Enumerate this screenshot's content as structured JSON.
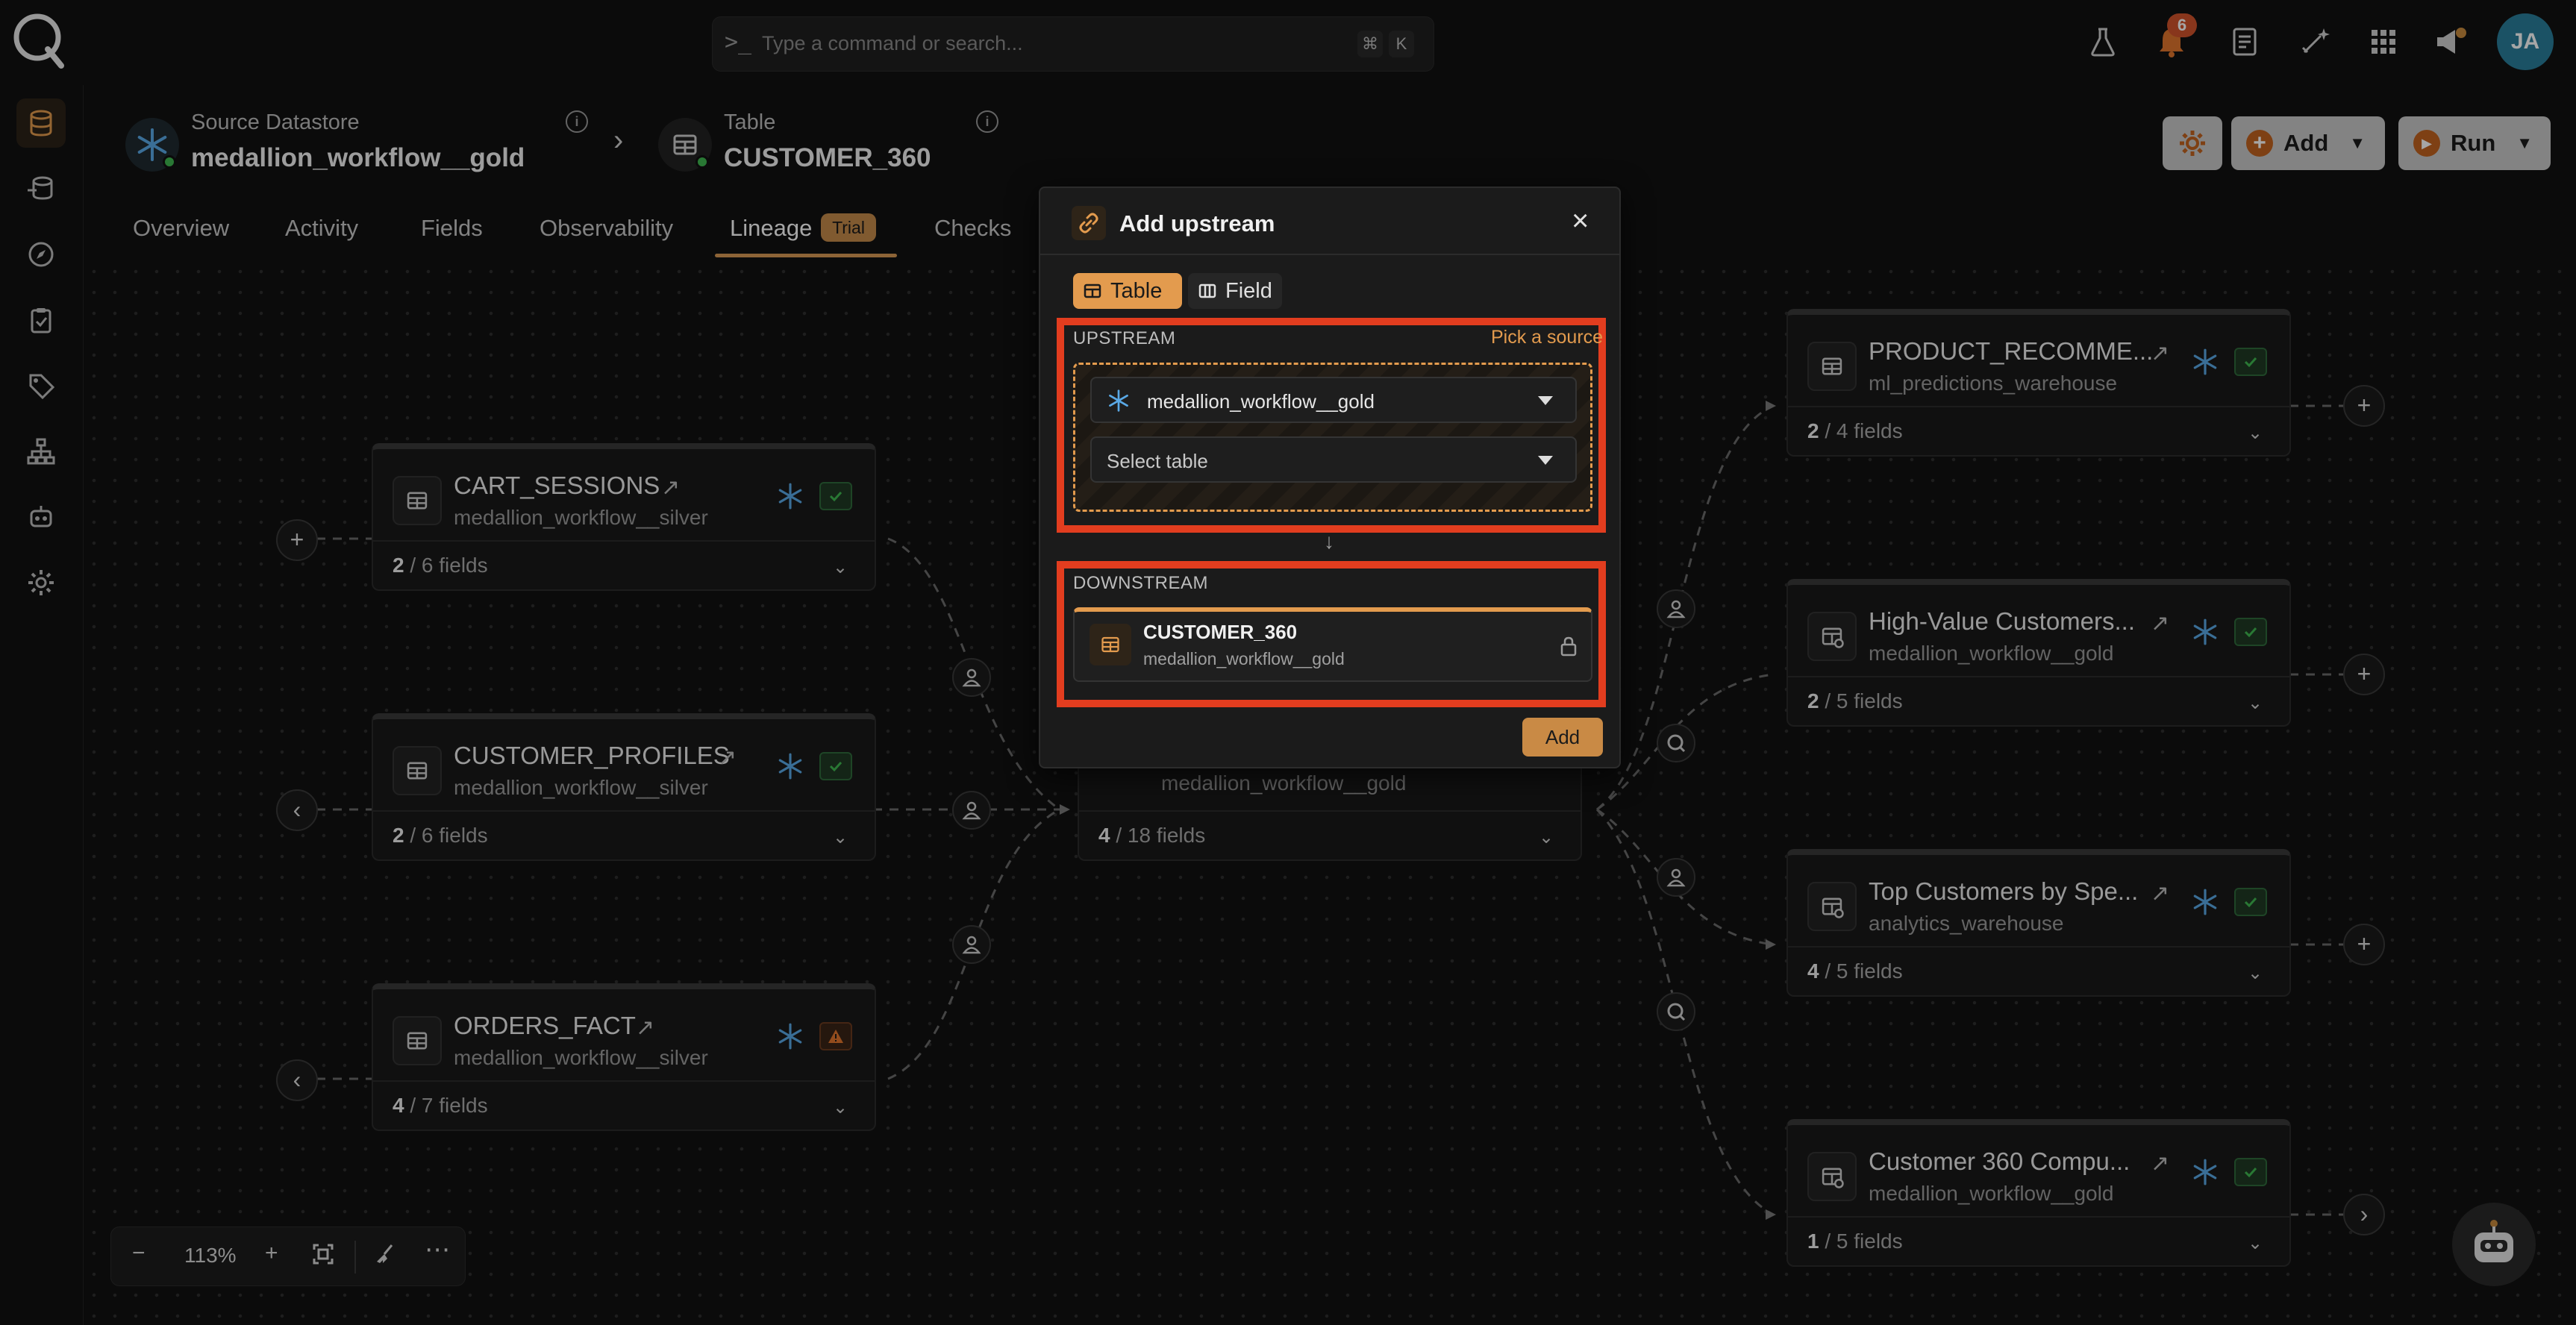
{
  "topbar": {
    "command_placeholder": "Type a command or search...",
    "shortcut_keys": [
      "⌘",
      "K"
    ],
    "notification_count": "6",
    "avatar_initials": "JA"
  },
  "header": {
    "source_label": "Source Datastore",
    "source_name": "medallion_workflow__gold",
    "table_label": "Table",
    "table_name": "CUSTOMER_360",
    "add_label": "Add",
    "run_label": "Run"
  },
  "tabs": [
    {
      "label": "Overview"
    },
    {
      "label": "Activity"
    },
    {
      "label": "Fields"
    },
    {
      "label": "Observability"
    },
    {
      "label": "Lineage",
      "badge": "Trial"
    },
    {
      "label": "Checks"
    }
  ],
  "nodes": {
    "cart_sessions": {
      "title": "CART_SESSIONS",
      "subtitle": "medallion_workflow__silver",
      "fields_count": "2",
      "fields_total": " / 6 fields"
    },
    "customer_profiles": {
      "title": "CUSTOMER_PROFILES",
      "subtitle": "medallion_workflow__silver",
      "fields_count": "2",
      "fields_total": " / 6 fields"
    },
    "orders_fact": {
      "title": "ORDERS_FACT",
      "subtitle": "medallion_workflow__silver",
      "fields_count": "4",
      "fields_total": " / 7 fields"
    },
    "customer_360": {
      "subtitle": "medallion_workflow__gold",
      "fields_count": "4",
      "fields_total": " / 18 fields"
    },
    "product_recomme": {
      "title": "PRODUCT_RECOMME...",
      "subtitle": "ml_predictions_warehouse",
      "fields_count": "2",
      "fields_total": " / 4 fields"
    },
    "high_value": {
      "title": "High-Value Customers...",
      "subtitle": "medallion_workflow__gold",
      "fields_count": "2",
      "fields_total": " / 5 fields"
    },
    "top_customers": {
      "title": "Top Customers by Spe...",
      "subtitle": "analytics_warehouse",
      "fields_count": "4",
      "fields_total": " / 5 fields"
    },
    "customer_360_compu": {
      "title": "Customer 360 Compu...",
      "subtitle": "medallion_workflow__gold",
      "fields_count": "1",
      "fields_total": " / 5 fields"
    }
  },
  "zoom": {
    "level": "113%"
  },
  "modal": {
    "title": "Add upstream",
    "tab_table": "Table",
    "tab_field": "Field",
    "upstream_label": "UPSTREAM",
    "pick_source": "Pick a source",
    "datastore_value": "medallion_workflow__gold",
    "table_placeholder": "Select table",
    "downstream_label": "DOWNSTREAM",
    "downstream_title": "CUSTOMER_360",
    "downstream_subtitle": "medallion_workflow__gold",
    "add_label": "Add"
  },
  "colors": {
    "accent": "#e39b4e",
    "highlight": "#e23d1f",
    "ok": "#3fb950",
    "snowflake": "#5aa9e6"
  }
}
